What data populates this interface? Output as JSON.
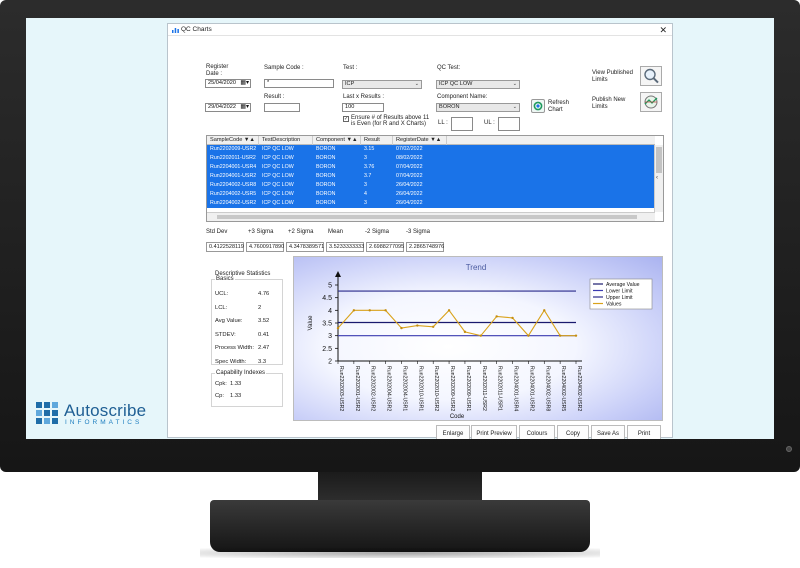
{
  "window": {
    "title": "QC Charts"
  },
  "filters": {
    "register_date_label": "Register\nDate :",
    "date_from": "25/04/2020",
    "date_to": "29/04/2022",
    "sample_code_label": "Sample Code :",
    "sample_code_value": "*",
    "result_label": "Result :",
    "result_value": "",
    "test_label": "Test :",
    "test_value": "ICP",
    "last_results_label": "Last x Results :",
    "last_results_value": "100",
    "ensure_even_text": "Ensure # of Results above 11 is Even (for R and X Charts)",
    "qc_test_label": "QC Test:",
    "qc_test_value": "ICP QC LOW",
    "component_label": "Component Name:",
    "component_value": "BORON",
    "ll_label": "LL :",
    "ul_label": "UL :",
    "refresh_label": "Refresh\nChart",
    "view_published_label": "View Published\nLimits",
    "publish_new_label": "Publish New\nLimits"
  },
  "grid": {
    "columns": [
      "SampleCode ▼▲",
      "TestDescription ▼▲",
      "Component ▼▲",
      "Result ▼▲",
      "RegisterDate ▼▲"
    ],
    "rows": [
      [
        "Run2202009-USR2",
        "ICP QC LOW",
        "BORON",
        "3.15",
        "07/02/2022"
      ],
      [
        "Run2202011-USR2",
        "ICP QC LOW",
        "BORON",
        "3",
        "08/02/2022"
      ],
      [
        "Run2204001-USR4",
        "ICP QC LOW",
        "BORON",
        "3.76",
        "07/04/2022"
      ],
      [
        "Run2204001-USR2",
        "ICP QC LOW",
        "BORON",
        "3.7",
        "07/04/2022"
      ],
      [
        "Run2204002-USR8",
        "ICP QC LOW",
        "BORON",
        "3",
        "26/04/2022"
      ],
      [
        "Run2204002-USR5",
        "ICP QC LOW",
        "BORON",
        "4",
        "26/04/2022"
      ],
      [
        "Run2204002-USR2",
        "ICP QC LOW",
        "BORON",
        "3",
        "26/04/2022"
      ]
    ]
  },
  "stats": {
    "labels": [
      "Std Dev",
      "+3 Sigma",
      "+2 Sigma",
      "Mean",
      "-2 Sigma",
      "-3 Sigma"
    ],
    "values": [
      "0.4122528119",
      "4.7600917890",
      "4.3478389571",
      "3.5233333333",
      "2.6988277095",
      "2.2865748976"
    ]
  },
  "descriptive": {
    "title": "Descriptive Statistics",
    "basics_label": "Basics",
    "items": [
      {
        "label": "UCL:",
        "value": "4.76"
      },
      {
        "label": "LCL:",
        "value": "2"
      },
      {
        "label": "Avg Value:",
        "value": "3.52"
      },
      {
        "label": "STDEV:",
        "value": "0.41"
      },
      {
        "label": "Process Width:",
        "value": "2.47"
      },
      {
        "label": "Spec Width:",
        "value": "3.3"
      }
    ],
    "capability_label": "Capability Indexes",
    "capability": [
      {
        "label": "Cpk:",
        "value": "1.33"
      },
      {
        "label": "Cp:",
        "value": "1.33"
      }
    ]
  },
  "chart_data": {
    "type": "line",
    "title": "Trend",
    "xlabel": "Code",
    "ylabel": "Value",
    "ylim": [
      2,
      5
    ],
    "yticks": [
      "2",
      "2.5",
      "3",
      "3.5",
      "4",
      "4.5",
      "5"
    ],
    "categories": [
      "Run2202003-USR2",
      "Run2202001-USR2",
      "Run2202002-USR2",
      "Run2202004-USR2",
      "Run2202004-USR1",
      "Run2202010-USR1",
      "Run2202010-USR2",
      "Run2202009-USR2",
      "Run2202009-USR1",
      "Run2202011-USR2",
      "Run2202011-USR1",
      "Run2204001-USR4",
      "Run2204001-USR2",
      "Run2204002-USR8",
      "Run2204002-USR5",
      "Run2204002-USR2"
    ],
    "series": [
      {
        "name": "Average Value",
        "values": [
          3.52,
          3.52,
          3.52,
          3.52,
          3.52,
          3.52,
          3.52,
          3.52,
          3.52,
          3.52,
          3.52,
          3.52,
          3.52,
          3.52,
          3.52,
          3.52
        ],
        "color": "#1a1a6e"
      },
      {
        "name": "Lower Limit",
        "values": [
          3,
          3,
          3,
          3,
          3,
          3,
          3,
          3,
          3,
          3,
          3,
          3,
          3,
          3,
          3,
          3
        ],
        "color": "#3b3bb0"
      },
      {
        "name": "Upper Limit",
        "values": [
          4.76,
          4.76,
          4.76,
          4.76,
          4.76,
          4.76,
          4.76,
          4.76,
          4.76,
          4.76,
          4.76,
          4.76,
          4.76,
          4.76,
          4.76,
          4.76
        ],
        "color": "#2a2a8a"
      },
      {
        "name": "Values",
        "values": [
          3.3,
          4.0,
          4.0,
          4.0,
          3.3,
          3.4,
          3.35,
          4.0,
          3.15,
          3.0,
          3.76,
          3.7,
          3.0,
          4.0,
          3.0,
          3.0
        ],
        "color": "#d9a21a"
      }
    ],
    "legend": "top-right",
    "grid": false
  },
  "buttons": [
    "Enlarge",
    "Print Preview",
    "Colours",
    "Copy",
    "Save As",
    "Print"
  ],
  "brand": {
    "name": "Autoscribe",
    "sub": "INFORMATICS"
  }
}
